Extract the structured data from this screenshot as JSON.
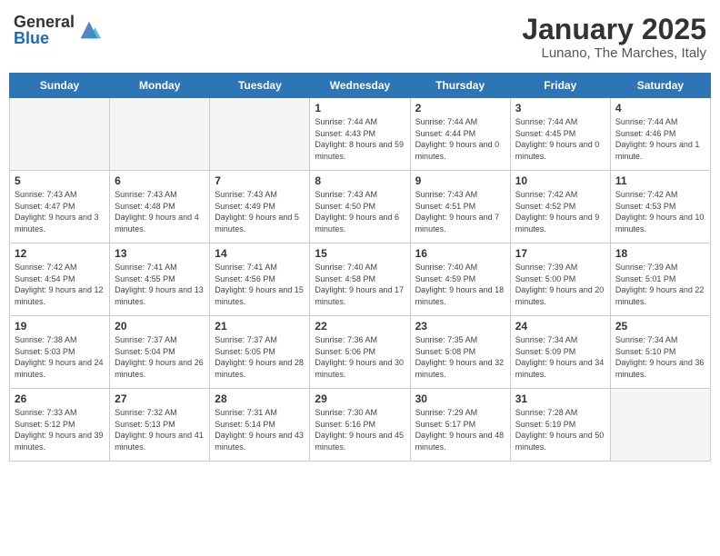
{
  "header": {
    "logo_general": "General",
    "logo_blue": "Blue",
    "month_year": "January 2025",
    "location": "Lunano, The Marches, Italy"
  },
  "weekdays": [
    "Sunday",
    "Monday",
    "Tuesday",
    "Wednesday",
    "Thursday",
    "Friday",
    "Saturday"
  ],
  "weeks": [
    [
      {
        "day": "",
        "info": ""
      },
      {
        "day": "",
        "info": ""
      },
      {
        "day": "",
        "info": ""
      },
      {
        "day": "1",
        "info": "Sunrise: 7:44 AM\nSunset: 4:43 PM\nDaylight: 8 hours and 59 minutes."
      },
      {
        "day": "2",
        "info": "Sunrise: 7:44 AM\nSunset: 4:44 PM\nDaylight: 9 hours and 0 minutes."
      },
      {
        "day": "3",
        "info": "Sunrise: 7:44 AM\nSunset: 4:45 PM\nDaylight: 9 hours and 0 minutes."
      },
      {
        "day": "4",
        "info": "Sunrise: 7:44 AM\nSunset: 4:46 PM\nDaylight: 9 hours and 1 minute."
      }
    ],
    [
      {
        "day": "5",
        "info": "Sunrise: 7:43 AM\nSunset: 4:47 PM\nDaylight: 9 hours and 3 minutes."
      },
      {
        "day": "6",
        "info": "Sunrise: 7:43 AM\nSunset: 4:48 PM\nDaylight: 9 hours and 4 minutes."
      },
      {
        "day": "7",
        "info": "Sunrise: 7:43 AM\nSunset: 4:49 PM\nDaylight: 9 hours and 5 minutes."
      },
      {
        "day": "8",
        "info": "Sunrise: 7:43 AM\nSunset: 4:50 PM\nDaylight: 9 hours and 6 minutes."
      },
      {
        "day": "9",
        "info": "Sunrise: 7:43 AM\nSunset: 4:51 PM\nDaylight: 9 hours and 7 minutes."
      },
      {
        "day": "10",
        "info": "Sunrise: 7:42 AM\nSunset: 4:52 PM\nDaylight: 9 hours and 9 minutes."
      },
      {
        "day": "11",
        "info": "Sunrise: 7:42 AM\nSunset: 4:53 PM\nDaylight: 9 hours and 10 minutes."
      }
    ],
    [
      {
        "day": "12",
        "info": "Sunrise: 7:42 AM\nSunset: 4:54 PM\nDaylight: 9 hours and 12 minutes."
      },
      {
        "day": "13",
        "info": "Sunrise: 7:41 AM\nSunset: 4:55 PM\nDaylight: 9 hours and 13 minutes."
      },
      {
        "day": "14",
        "info": "Sunrise: 7:41 AM\nSunset: 4:56 PM\nDaylight: 9 hours and 15 minutes."
      },
      {
        "day": "15",
        "info": "Sunrise: 7:40 AM\nSunset: 4:58 PM\nDaylight: 9 hours and 17 minutes."
      },
      {
        "day": "16",
        "info": "Sunrise: 7:40 AM\nSunset: 4:59 PM\nDaylight: 9 hours and 18 minutes."
      },
      {
        "day": "17",
        "info": "Sunrise: 7:39 AM\nSunset: 5:00 PM\nDaylight: 9 hours and 20 minutes."
      },
      {
        "day": "18",
        "info": "Sunrise: 7:39 AM\nSunset: 5:01 PM\nDaylight: 9 hours and 22 minutes."
      }
    ],
    [
      {
        "day": "19",
        "info": "Sunrise: 7:38 AM\nSunset: 5:03 PM\nDaylight: 9 hours and 24 minutes."
      },
      {
        "day": "20",
        "info": "Sunrise: 7:37 AM\nSunset: 5:04 PM\nDaylight: 9 hours and 26 minutes."
      },
      {
        "day": "21",
        "info": "Sunrise: 7:37 AM\nSunset: 5:05 PM\nDaylight: 9 hours and 28 minutes."
      },
      {
        "day": "22",
        "info": "Sunrise: 7:36 AM\nSunset: 5:06 PM\nDaylight: 9 hours and 30 minutes."
      },
      {
        "day": "23",
        "info": "Sunrise: 7:35 AM\nSunset: 5:08 PM\nDaylight: 9 hours and 32 minutes."
      },
      {
        "day": "24",
        "info": "Sunrise: 7:34 AM\nSunset: 5:09 PM\nDaylight: 9 hours and 34 minutes."
      },
      {
        "day": "25",
        "info": "Sunrise: 7:34 AM\nSunset: 5:10 PM\nDaylight: 9 hours and 36 minutes."
      }
    ],
    [
      {
        "day": "26",
        "info": "Sunrise: 7:33 AM\nSunset: 5:12 PM\nDaylight: 9 hours and 39 minutes."
      },
      {
        "day": "27",
        "info": "Sunrise: 7:32 AM\nSunset: 5:13 PM\nDaylight: 9 hours and 41 minutes."
      },
      {
        "day": "28",
        "info": "Sunrise: 7:31 AM\nSunset: 5:14 PM\nDaylight: 9 hours and 43 minutes."
      },
      {
        "day": "29",
        "info": "Sunrise: 7:30 AM\nSunset: 5:16 PM\nDaylight: 9 hours and 45 minutes."
      },
      {
        "day": "30",
        "info": "Sunrise: 7:29 AM\nSunset: 5:17 PM\nDaylight: 9 hours and 48 minutes."
      },
      {
        "day": "31",
        "info": "Sunrise: 7:28 AM\nSunset: 5:19 PM\nDaylight: 9 hours and 50 minutes."
      },
      {
        "day": "",
        "info": ""
      }
    ]
  ]
}
